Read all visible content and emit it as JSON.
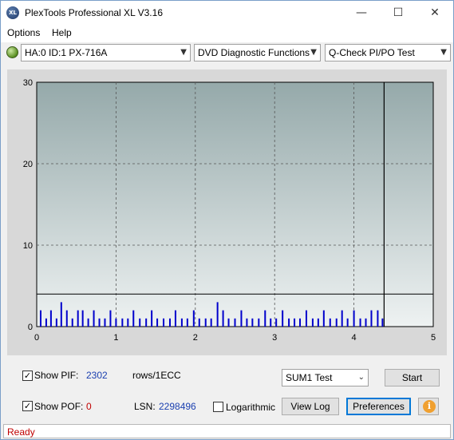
{
  "window": {
    "title": "PlexTools Professional XL V3.16",
    "app_icon_text": "XL",
    "minimize_glyph": "—",
    "maximize_glyph": "☐",
    "close_glyph": "✕"
  },
  "menu": {
    "options": "Options",
    "help": "Help"
  },
  "toolbar": {
    "drive": "HA:0 ID:1  PX-716A",
    "function": "DVD Diagnostic Functions",
    "test": "Q-Check PI/PO Test"
  },
  "chart_data": {
    "type": "bar",
    "xlim": [
      0,
      5
    ],
    "ylim": [
      0,
      30
    ],
    "x_ticks": [
      "0",
      "1",
      "2",
      "3",
      "4",
      "5"
    ],
    "y_ticks": [
      "0",
      "10",
      "20",
      "30"
    ],
    "grid": true,
    "grid_style": "dashed",
    "threshold_y": 4,
    "end_marker_x": 4.38,
    "series": [
      {
        "color": "#0000cc",
        "x": [
          0.05,
          0.12,
          0.18,
          0.25,
          0.31,
          0.38,
          0.45,
          0.52,
          0.58,
          0.65,
          0.72,
          0.79,
          0.86,
          0.93,
          1.0,
          1.08,
          1.15,
          1.22,
          1.3,
          1.38,
          1.45,
          1.52,
          1.6,
          1.68,
          1.75,
          1.83,
          1.9,
          1.98,
          2.05,
          2.13,
          2.2,
          2.28,
          2.35,
          2.42,
          2.5,
          2.58,
          2.65,
          2.72,
          2.8,
          2.88,
          2.95,
          3.02,
          3.1,
          3.18,
          3.25,
          3.32,
          3.4,
          3.48,
          3.55,
          3.62,
          3.7,
          3.78,
          3.85,
          3.92,
          4.0,
          4.08,
          4.15,
          4.22,
          4.3,
          4.36
        ],
        "values": [
          2,
          1,
          2,
          1,
          3,
          2,
          1,
          2,
          2,
          1,
          2,
          1,
          1,
          2,
          1,
          1,
          1,
          2,
          1,
          1,
          2,
          1,
          1,
          1,
          2,
          1,
          1,
          2,
          1,
          1,
          1,
          3,
          2,
          1,
          1,
          2,
          1,
          1,
          1,
          2,
          1,
          1,
          2,
          1,
          1,
          1,
          2,
          1,
          1,
          2,
          1,
          1,
          2,
          1,
          2,
          1,
          1,
          2,
          2,
          1
        ]
      }
    ]
  },
  "controls": {
    "show_pif_label": "Show PIF:",
    "pif_value": "2302",
    "pif_unit": "rows/1ECC",
    "show_pof_label": "Show POF:",
    "pof_value": "0",
    "lsn_label": "LSN:",
    "lsn_value": "2298496",
    "log_label": "Logarithmic",
    "sum_select": "SUM1 Test",
    "start_label": "Start",
    "viewlog_label": "View Log",
    "prefs_label": "Preferences",
    "check_glyph": "✓",
    "info_glyph": "i",
    "show_pif_checked": true,
    "show_pof_checked": true,
    "log_checked": false
  },
  "status": {
    "text": "Ready"
  },
  "colors": {
    "bar": "#0000cc",
    "plot_bg_top": "#95a9aa",
    "plot_bg_bottom": "#eef2f2",
    "status_text": "#c00000",
    "value_blue": "#1a3fb0"
  }
}
